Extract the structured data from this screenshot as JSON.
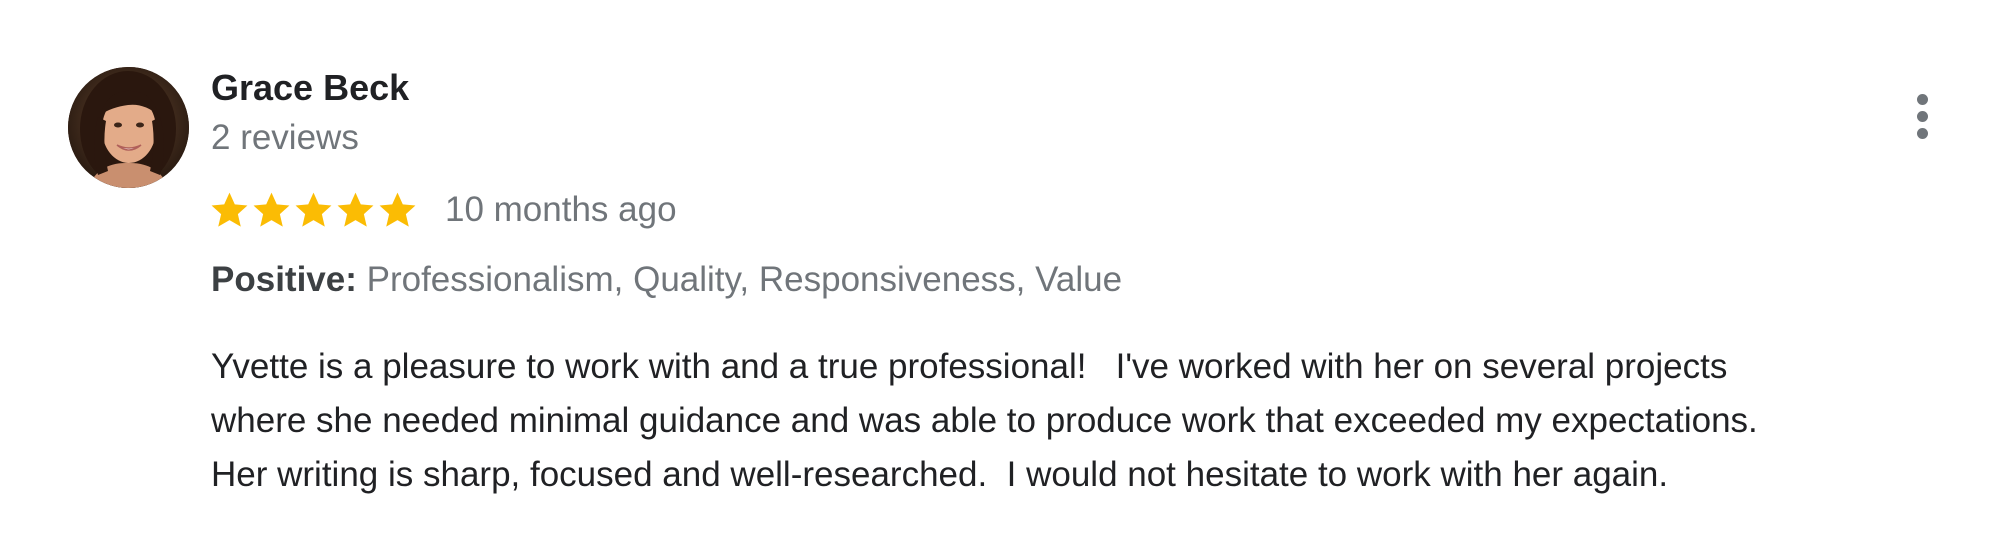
{
  "reviewer": {
    "name": "Grace Beck",
    "review_count": "2 reviews",
    "avatar": "profile-photo"
  },
  "rating": {
    "stars": 5,
    "max_stars": 5,
    "star_color": "#fbbc04",
    "time_ago": "10 months ago"
  },
  "attributes": {
    "label": "Positive:",
    "values": "Professionalism, Quality, Responsiveness, Value"
  },
  "review_text": {
    "lines": [
      "Yvette is a pleasure to work with and a true professional!   I've worked with her on several projects",
      "where she needed minimal guidance and was able to produce work that exceeded my expectations.",
      "Her writing is sharp, focused and well-researched.  I would not hesitate to work with her again."
    ]
  },
  "menu": {
    "icon": "more-vert-icon"
  },
  "colors": {
    "name": "#202124",
    "secondary": "#70757a",
    "label": "#3c4043",
    "star": "#fbbc04"
  }
}
